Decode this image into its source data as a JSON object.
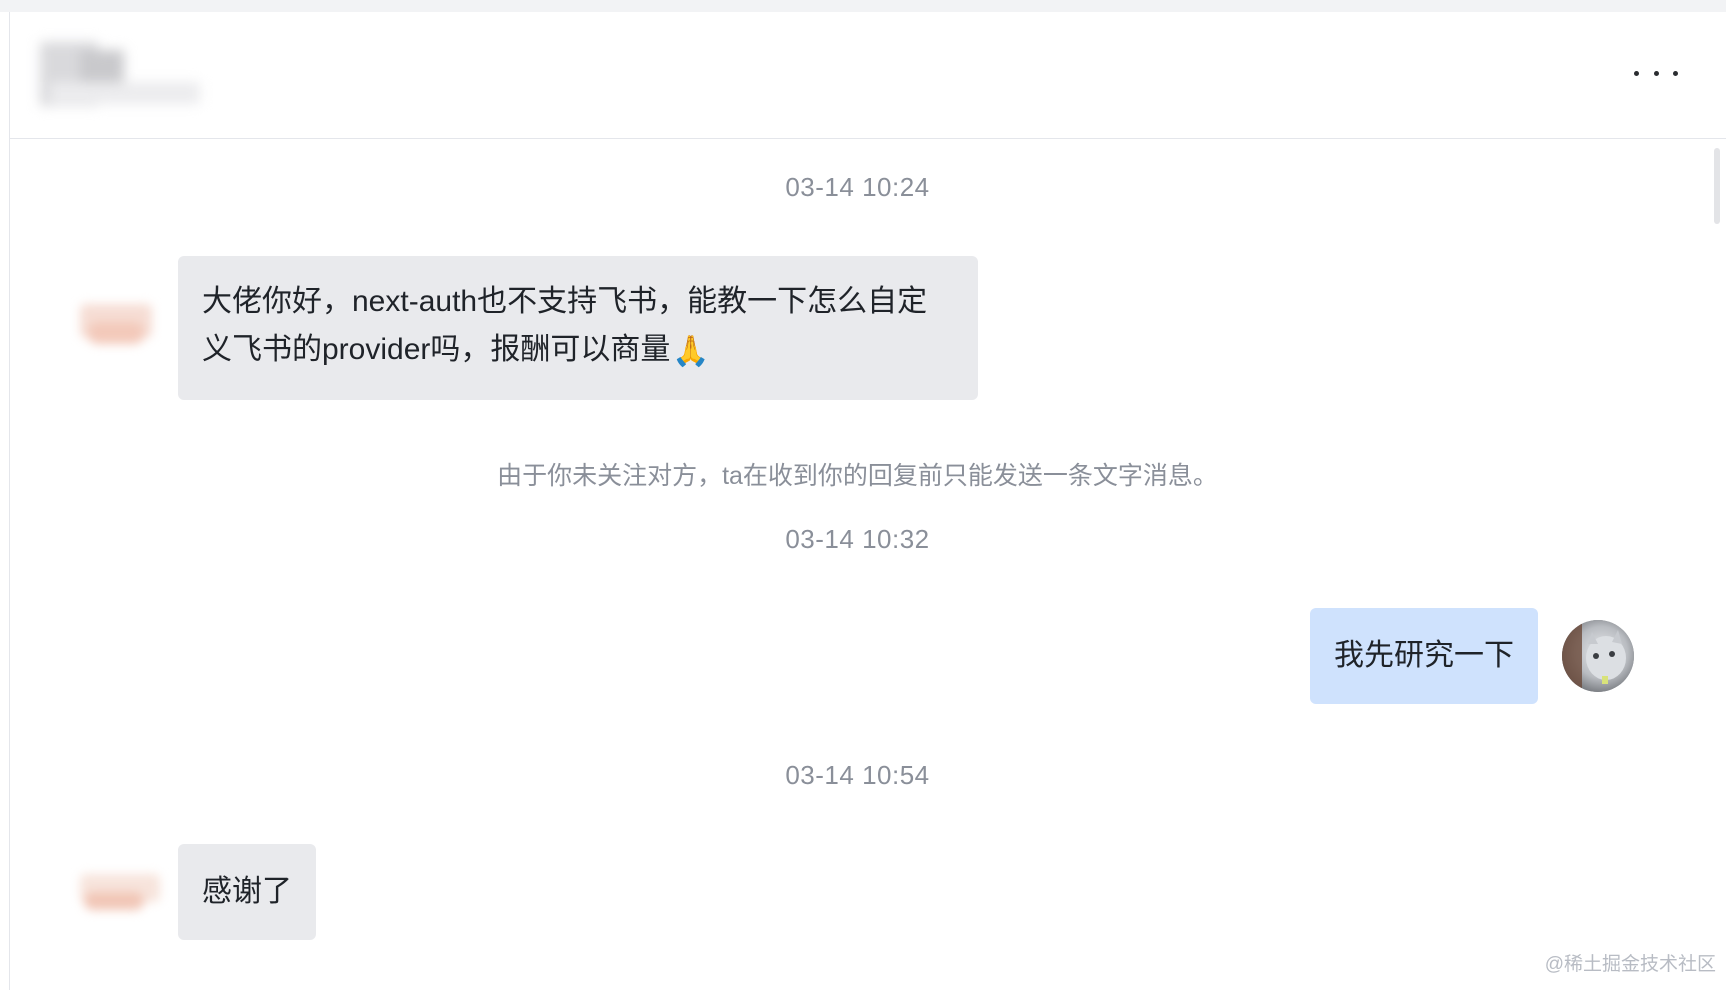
{
  "header": {
    "contact_name_hidden": true,
    "more_icon": "more-horizontal-icon"
  },
  "messages": [
    {
      "type": "timestamp",
      "text": "03-14 10:24"
    },
    {
      "type": "incoming",
      "line1": "大佬你好，next-auth也不支持飞书，能教一下怎么自定",
      "line2": "义飞书的provider吗，报酬可以商量",
      "emoji": "🙏"
    },
    {
      "type": "notice",
      "text": "由于你未关注对方，ta在收到你的回复前只能发送一条文字消息。"
    },
    {
      "type": "timestamp",
      "text": "03-14 10:32"
    },
    {
      "type": "outgoing",
      "text": "我先研究一下"
    },
    {
      "type": "timestamp",
      "text": "03-14 10:54"
    },
    {
      "type": "incoming",
      "text": "感谢了"
    }
  ],
  "watermark": "@稀土掘金技术社区",
  "colors": {
    "incoming_bubble": "#e9eaed",
    "outgoing_bubble": "#cfe2fd",
    "timestamp": "#8a8f99"
  }
}
